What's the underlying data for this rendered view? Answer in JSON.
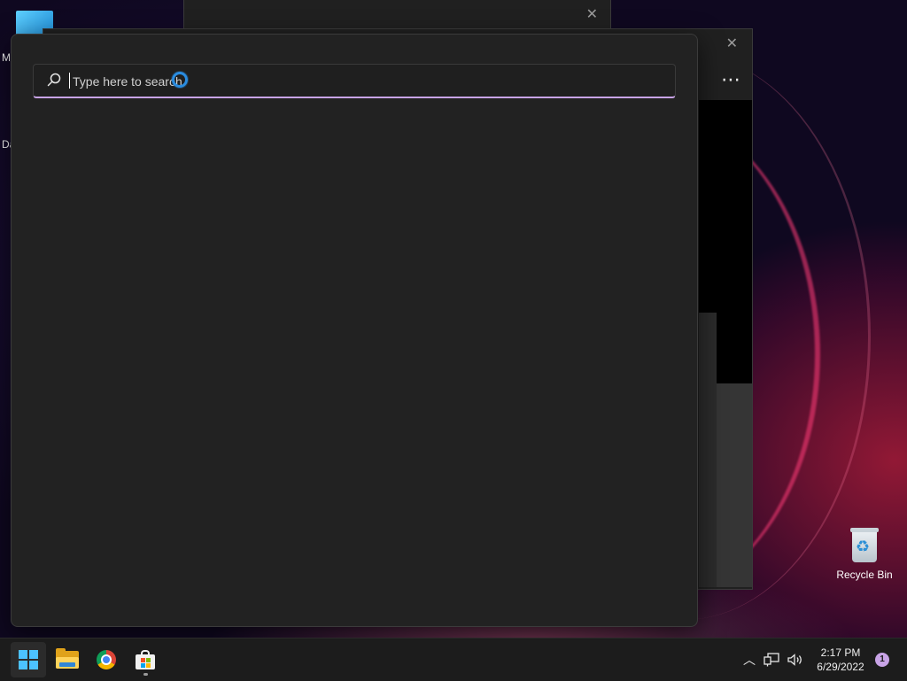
{
  "desktop": {
    "fragment_1": "M",
    "fragment_2": "Da",
    "recycle_bin_label": "Recycle Bin"
  },
  "search": {
    "placeholder": "Type here to search",
    "value": "",
    "accent_color": "#c8a3e6",
    "busy_indicator_color": "#2a8ce0"
  },
  "background_windows": {
    "top_close_icon": "close-icon",
    "right_close_icon": "close-icon",
    "right_more_icon": "more-icon"
  },
  "taskbar": {
    "pinned": [
      "start-icon",
      "file-explorer-icon",
      "chrome-icon",
      "store-icon"
    ],
    "time": "2:17 PM",
    "date": "6/29/2022",
    "notification_count": "1",
    "tray_icons": [
      "show-hidden-icons-icon",
      "network-icon",
      "volume-icon"
    ]
  }
}
